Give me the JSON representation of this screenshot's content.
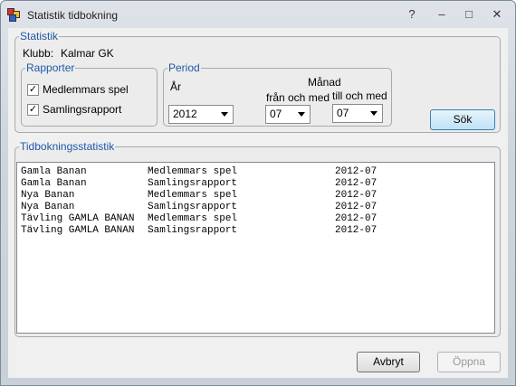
{
  "window": {
    "title": "Statistik tidbokning",
    "help_glyph": "?",
    "minimize_glyph": "–",
    "maximize_glyph": "□",
    "close_glyph": "✕"
  },
  "statistik": {
    "legend": "Statistik",
    "club_label": "Klubb:",
    "club_value": "Kalmar GK",
    "rapporter": {
      "legend": "Rapporter",
      "medlemmars_spel": {
        "label": "Medlemmars spel",
        "checked": true
      },
      "samlingsrapport": {
        "label": "Samlingsrapport",
        "checked": true
      }
    },
    "period": {
      "legend": "Period",
      "year_label": "År",
      "month_label": "Månad",
      "from_label": "från och med",
      "to_label": "till och med",
      "year_value": "2012",
      "from_value": "07",
      "to_value": "07"
    },
    "search_button": "Sök"
  },
  "tidbokning": {
    "legend": "Tidbokningsstatistik",
    "rows": [
      {
        "course": "Gamla Banan",
        "report": "Medlemmars spel",
        "period": "2012-07"
      },
      {
        "course": "Gamla Banan",
        "report": "Samlingsrapport",
        "period": "2012-07"
      },
      {
        "course": "Nya Banan",
        "report": "Medlemmars spel",
        "period": "2012-07"
      },
      {
        "course": "Nya Banan",
        "report": "Samlingsrapport",
        "period": "2012-07"
      },
      {
        "course": "Tävling GAMLA BANAN",
        "report": "Medlemmars spel",
        "period": "2012-07"
      },
      {
        "course": "Tävling GAMLA BANAN",
        "report": "Samlingsrapport",
        "period": "2012-07"
      }
    ]
  },
  "footer": {
    "cancel": "Avbryt",
    "open": "Öppna",
    "open_enabled": false
  },
  "icons": {
    "app": "app-icon"
  },
  "colors": {
    "legend_text": "#1e5aa8",
    "accent_button": "#bfe1f6"
  }
}
